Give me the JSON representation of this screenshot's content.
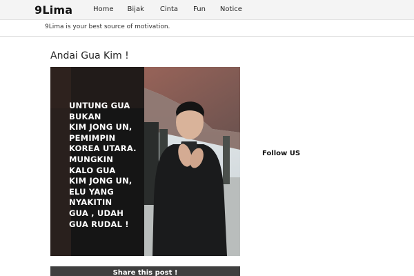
{
  "site": {
    "logo": "9Lima",
    "tagline": "9Lima is your best source of motivation."
  },
  "nav": {
    "items": [
      {
        "label": "Home"
      },
      {
        "label": "Bijak"
      },
      {
        "label": "Cinta"
      },
      {
        "label": "Fun"
      },
      {
        "label": "Notice"
      }
    ]
  },
  "post": {
    "title": "Andai Gua Kim !",
    "image_text_lines": [
      "UNTUNG GUA",
      "BUKAN",
      "KIM JONG UN,",
      "PEMIMPIN",
      "KOREA UTARA.",
      "MUNGKIN",
      "KALO GUA",
      "KIM JONG UN,",
      "ELU YANG",
      "NYAKITIN",
      "GUA , UDAH",
      "GUA RUDAL !"
    ],
    "share_label": "Share this post !"
  },
  "sidebar": {
    "follow_label": "Follow US"
  }
}
